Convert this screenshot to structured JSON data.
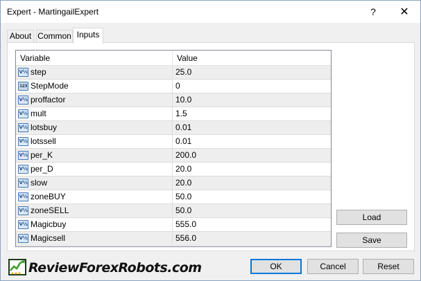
{
  "window": {
    "title": "Expert - MartingailExpert",
    "help_glyph": "?",
    "close_glyph": "✕"
  },
  "tabs": [
    {
      "label": "About",
      "active": false
    },
    {
      "label": "Common",
      "active": false
    },
    {
      "label": "Inputs",
      "active": true
    }
  ],
  "grid": {
    "columns": {
      "variable": "Variable",
      "value": "Value"
    },
    "rows": [
      {
        "icon": "double-value-icon",
        "glyph": "V½",
        "name": "step",
        "value": "25.0"
      },
      {
        "icon": "integer-value-icon",
        "glyph": "123",
        "name": "StepMode",
        "value": "0"
      },
      {
        "icon": "double-value-icon",
        "glyph": "V½",
        "name": "proffactor",
        "value": "10.0"
      },
      {
        "icon": "double-value-icon",
        "glyph": "V½",
        "name": "mult",
        "value": "1.5"
      },
      {
        "icon": "double-value-icon",
        "glyph": "V½",
        "name": "lotsbuy",
        "value": "0.01"
      },
      {
        "icon": "double-value-icon",
        "glyph": "V½",
        "name": "lotssell",
        "value": "0.01"
      },
      {
        "icon": "double-value-icon",
        "glyph": "V½",
        "name": "per_K",
        "value": "200.0"
      },
      {
        "icon": "double-value-icon",
        "glyph": "V½",
        "name": "per_D",
        "value": "20.0"
      },
      {
        "icon": "double-value-icon",
        "glyph": "V½",
        "name": "slow",
        "value": "20.0"
      },
      {
        "icon": "double-value-icon",
        "glyph": "V½",
        "name": "zoneBUY",
        "value": "50.0"
      },
      {
        "icon": "double-value-icon",
        "glyph": "V½",
        "name": "zoneSELL",
        "value": "50.0"
      },
      {
        "icon": "double-value-icon",
        "glyph": "V½",
        "name": "Magicbuy",
        "value": "555.0"
      },
      {
        "icon": "double-value-icon",
        "glyph": "V½",
        "name": "Magicsell",
        "value": "556.0"
      }
    ]
  },
  "side_buttons": {
    "load": "Load",
    "save": "Save"
  },
  "footer_buttons": {
    "ok": "OK",
    "cancel": "Cancel",
    "reset": "Reset"
  },
  "watermark": {
    "text": "ReviewForexRobots.com"
  },
  "colors": {
    "accent": "#0078d7",
    "row_alt": "#eeeeee",
    "icon_border": "#3d78b8"
  }
}
